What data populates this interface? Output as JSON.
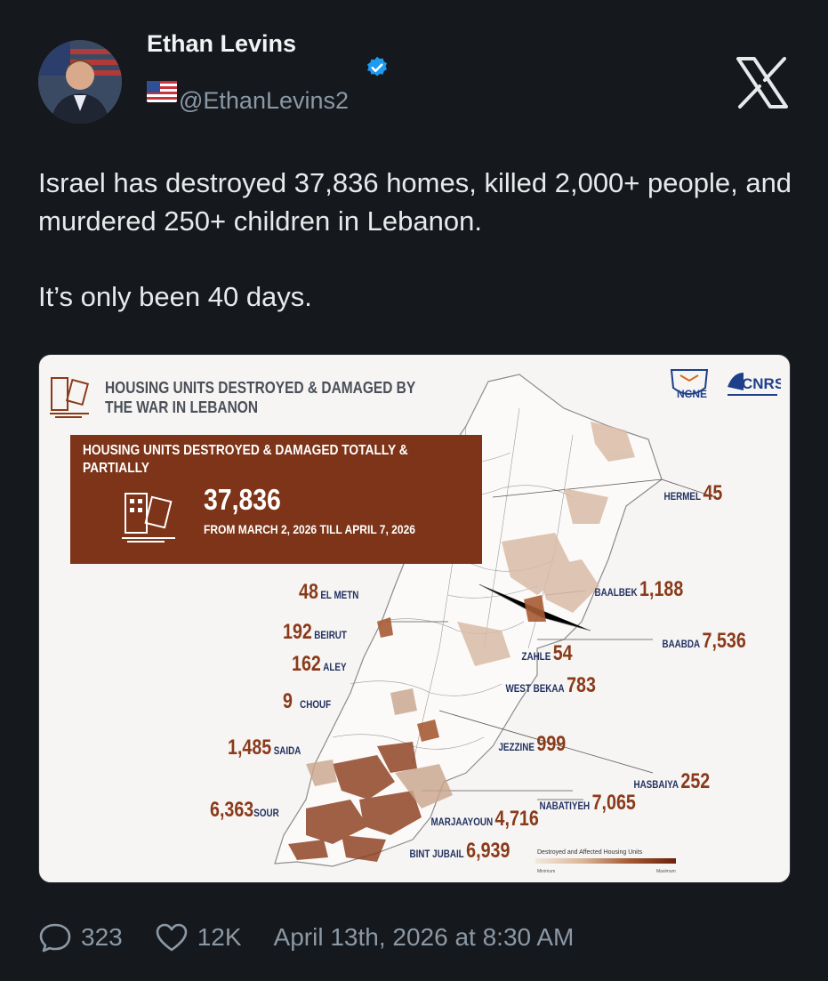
{
  "author": {
    "name": "Ethan Levins",
    "handle": "@EthanLevins2",
    "flag_emoji": "🇺🇸",
    "verified_color": "#1d9bf0"
  },
  "tweet": {
    "paragraphs": [
      "Israel has destroyed 37,836 homes, killed 2,000+ people, and murdered 250+ children in Lebanon.",
      "It’s only been 40 days."
    ]
  },
  "infographic": {
    "title": "HOUSING UNITS DESTROYED & DAMAGED BY THE WAR IN LEBANON",
    "banner_title": "HOUSING UNITS DESTROYED & DAMAGED TOTALLY & PARTIALLY",
    "total": "37,836",
    "date_range": "FROM MARCH 2, 2026 TILL APRIL 7, 2026",
    "logos": [
      "NCNE",
      "CNRS"
    ],
    "districts": [
      {
        "name": "EL METN",
        "value": "48"
      },
      {
        "name": "BEIRUT",
        "value": "192"
      },
      {
        "name": "ALEY",
        "value": "162"
      },
      {
        "name": "CHOUF",
        "value": "9"
      },
      {
        "name": "SAIDA",
        "value": "1,485"
      },
      {
        "name": "SOUR",
        "value": "6,363"
      },
      {
        "name": "HERMEL",
        "value": "45"
      },
      {
        "name": "BAALBEK",
        "value": "1,188"
      },
      {
        "name": "BAABDA",
        "value": "7,536"
      },
      {
        "name": "ZAHLE",
        "value": "54"
      },
      {
        "name": "WEST BEKAA",
        "value": "783"
      },
      {
        "name": "JEZZINE",
        "value": "999"
      },
      {
        "name": "HASBAIYA",
        "value": "252"
      },
      {
        "name": "NABATIYEH",
        "value": "7,065"
      },
      {
        "name": "MARJAAYOUN",
        "value": "4,716"
      },
      {
        "name": "BINT JUBAIL",
        "value": "6,939"
      }
    ],
    "legend": {
      "title": "Destroyed and Affected Housing Units",
      "min": "Minimum",
      "max": "Maximum"
    },
    "colors": {
      "banner": "#7d3418",
      "number": "#8a3a1a",
      "district": "#223061"
    }
  },
  "footer": {
    "replies": "323",
    "likes": "12K",
    "timestamp": "April 13th, 2026 at 8:30 AM"
  }
}
